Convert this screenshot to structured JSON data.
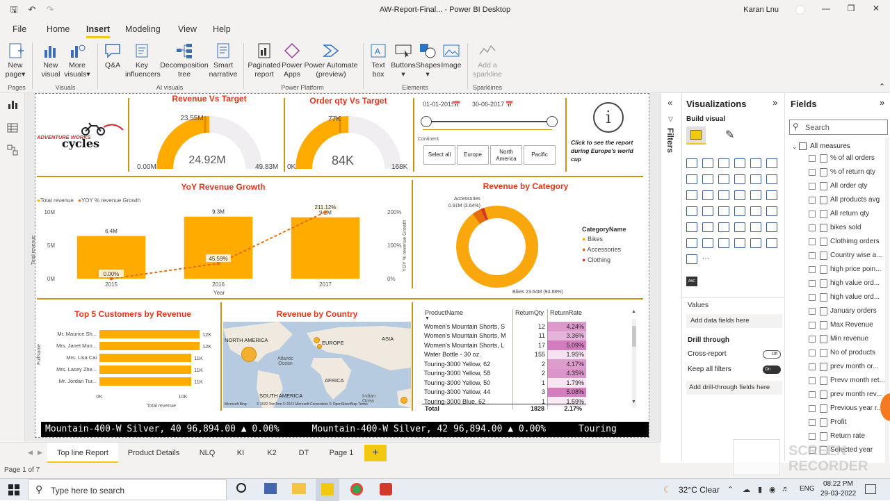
{
  "window": {
    "title": "AW-Report-Final... - Power BI Desktop",
    "user": "Karan Lnu"
  },
  "ribbon_tabs": [
    "File",
    "Home",
    "Insert",
    "Modeling",
    "View",
    "Help"
  ],
  "ribbon": {
    "new_page": "New\npage",
    "new_visual": "New\nvisual",
    "more_visuals": "More\nvisuals",
    "qa": "Q&A",
    "key_influencers": "Key\ninfluencers",
    "decomposition_tree": "Decomposition\ntree",
    "smart_narrative": "Smart\nnarrative",
    "paginated_report": "Paginated\nreport",
    "power_apps": "Power\nApps",
    "power_automate": "Power Automate\n(preview)",
    "text_box": "Text\nbox",
    "buttons": "Buttons",
    "shapes": "Shapes",
    "image": "Image",
    "add_sparkline": "Add a\nsparkline",
    "groups": {
      "pages": "Pages",
      "visuals": "Visuals",
      "ai_visuals": "AI visuals",
      "power_platform": "Power Platform",
      "elements": "Elements",
      "sparklines": "Sparklines"
    }
  },
  "report": {
    "logo_top": "ADVENTURE WORKS",
    "logo_bottom": "cycles",
    "revenue_vs_target": {
      "title": "Revenue Vs Target",
      "value": "24.92M",
      "target": "23.55M",
      "min": "0.00M",
      "max": "49.83M",
      "fraction": 0.5
    },
    "order_qty_vs_target": {
      "title": "Order qty Vs Target",
      "value": "84K",
      "target": "77K",
      "min": "0K",
      "max": "168K",
      "fraction": 0.5
    },
    "date_slicer": {
      "start": "01-01-2015",
      "end": "30-06-2017"
    },
    "continent_slicer": {
      "label": "Continent",
      "options": [
        "Select all",
        "Europe",
        "North\nAmerica",
        "Pacific"
      ]
    },
    "info": {
      "glyph": "i",
      "text": "Click to see the report during Europe's world cup"
    },
    "yoy": {
      "title": "YoY Revenue Growth",
      "legend": [
        "Total revenue",
        "YOY % revenue Growth"
      ],
      "ylabel": "Total revenue",
      "y2label": "YOY % revenue Growth",
      "xlabel": "Year",
      "yticks": [
        "10M",
        "5M",
        "0M"
      ],
      "y2ticks": [
        "200%",
        "100%",
        "0%"
      ]
    },
    "revenue_by_category": {
      "title": "Revenue by Category",
      "legend_title": "CategoryName",
      "label_accessories_1": "Accessories",
      "label_accessories_2": "0.91M (3.64%)",
      "label_bikes": "Bikes 23.64M (94.88%)"
    },
    "top5": {
      "title": "Top 5 Customers by Revenue",
      "ylabel": "FullName",
      "xlabel": "Total revenue",
      "xticks": [
        "0K",
        "10K"
      ]
    },
    "revenue_by_country": {
      "title": "Revenue by Country",
      "labels": [
        "NORTH AMERICA",
        "EUROPE",
        "ASIA",
        "Atlantic\nOcean",
        "AFRICA",
        "SOUTH AMERICA",
        "Indian\nOcea"
      ],
      "attribution": "© 2022 TomTom  © 2022 Microsoft Corporation  © OpenStreetMap  Terms",
      "brand": "Microsoft Bing"
    },
    "returns_table": {
      "headers": [
        "ProductName",
        "ReturnQty",
        "ReturnRate"
      ],
      "rows": [
        [
          "Women's Mountain Shorts, S",
          "12",
          "4.24%"
        ],
        [
          "Women's Mountain Shorts, M",
          "11",
          "3.36%"
        ],
        [
          "Women's Mountain Shorts, L",
          "17",
          "5.09%"
        ],
        [
          "Water Bottle - 30 oz.",
          "155",
          "1.95%"
        ],
        [
          "Touring-3000 Yellow, 62",
          "2",
          "4.17%"
        ],
        [
          "Touring-3000 Yellow, 58",
          "2",
          "4.35%"
        ],
        [
          "Touring-3000 Yellow, 50",
          "1",
          "1.79%"
        ],
        [
          "Touring-3000 Yellow, 44",
          "3",
          "5.08%"
        ],
        [
          "Touring-3000 Blue, 62",
          "1",
          "1.59%"
        ]
      ],
      "total": [
        "Total",
        "1828",
        "2.17%"
      ]
    },
    "ticker": "Mountain-400-W Silver, 40 96,894.00 ▲ 0.00%      Mountain-400-W Silver, 42 96,894.00 ▲ 0.00%      Touring"
  },
  "chart_data": [
    {
      "type": "bar",
      "title": "YoY Revenue Growth",
      "categories": [
        "2015",
        "2016",
        "2017"
      ],
      "series": [
        {
          "name": "Total revenue",
          "values": [
            6.4,
            9.3,
            9.2
          ],
          "unit": "M",
          "labels": [
            "6.4M",
            "9.3M",
            "9.2M"
          ]
        },
        {
          "name": "YOY % revenue Growth",
          "type": "line",
          "values": [
            0,
            45.59,
            211.12
          ],
          "labels": [
            "0.00%",
            "45.59%",
            "211.12%"
          ]
        }
      ],
      "ylim": [
        0,
        10
      ],
      "y2lim": [
        0,
        200
      ]
    },
    {
      "type": "pie",
      "title": "Revenue by Category",
      "categories": [
        "Bikes",
        "Accessories",
        "Clothing"
      ],
      "values": [
        94.88,
        3.64,
        1.48
      ],
      "colors": [
        "#f9a70c",
        "#e66c0c",
        "#d9391b"
      ]
    },
    {
      "type": "bar",
      "orientation": "horizontal",
      "title": "Top 5 Customers by Revenue",
      "categories": [
        "Mr. Maurice Sh...",
        "Mrs. Janet Mun...",
        "Mrs. Lisa Cai",
        "Mrs. Lacey Zhe...",
        "Mr. Jordan Tur..."
      ],
      "values": [
        12,
        12,
        11,
        11,
        11
      ],
      "labels": [
        "12K",
        "12K",
        "11K",
        "11K",
        "11K"
      ],
      "xlim": [
        0,
        13
      ],
      "unit": "K"
    }
  ],
  "visualizations": {
    "title": "Visualizations",
    "build_visual": "Build visual",
    "values": "Values",
    "add_data": "Add data fields here",
    "drill_through": "Drill through",
    "cross_report": "Cross-report",
    "cross_report_state": "Off",
    "keep_filters": "Keep all filters",
    "keep_filters_state": "On",
    "add_drill": "Add drill-through fields here",
    "filters_label": "Filters"
  },
  "fields": {
    "title": "Fields",
    "search_placeholder": "Search",
    "group": "All measures",
    "items": [
      "% of all orders",
      "% of return qty",
      "All order qty",
      "All products avg",
      "All return qty",
      "bikes sold",
      "Clothimg orders",
      "Country wise a...",
      "high price poin...",
      "high value ord...",
      "high value ord...",
      "January orders",
      "Max Revenue",
      "Min revenue",
      "No of products",
      "prev month or...",
      "Prevv month ret...",
      "prev month rev...",
      "Previous year r...",
      "Profit",
      "Return rate",
      "Selected year"
    ]
  },
  "page_tabs": [
    "Top line Report",
    "Product Details",
    "NLQ",
    "KI",
    "K2",
    "DT",
    "Page 1"
  ],
  "add_page": "+",
  "status": "Page 1 of 7",
  "watermark": "SCREEN\nRECORDER",
  "taskbar": {
    "search": "Type here to search",
    "weather": "32°C  Clear",
    "lang": "ENG",
    "time": "08:22 PM",
    "date": "29-03-2022"
  },
  "colors": {
    "accent": "#f2c811",
    "bar": "#ffab00",
    "title_red": "#e5361a",
    "gold_line": "#c4950e"
  }
}
